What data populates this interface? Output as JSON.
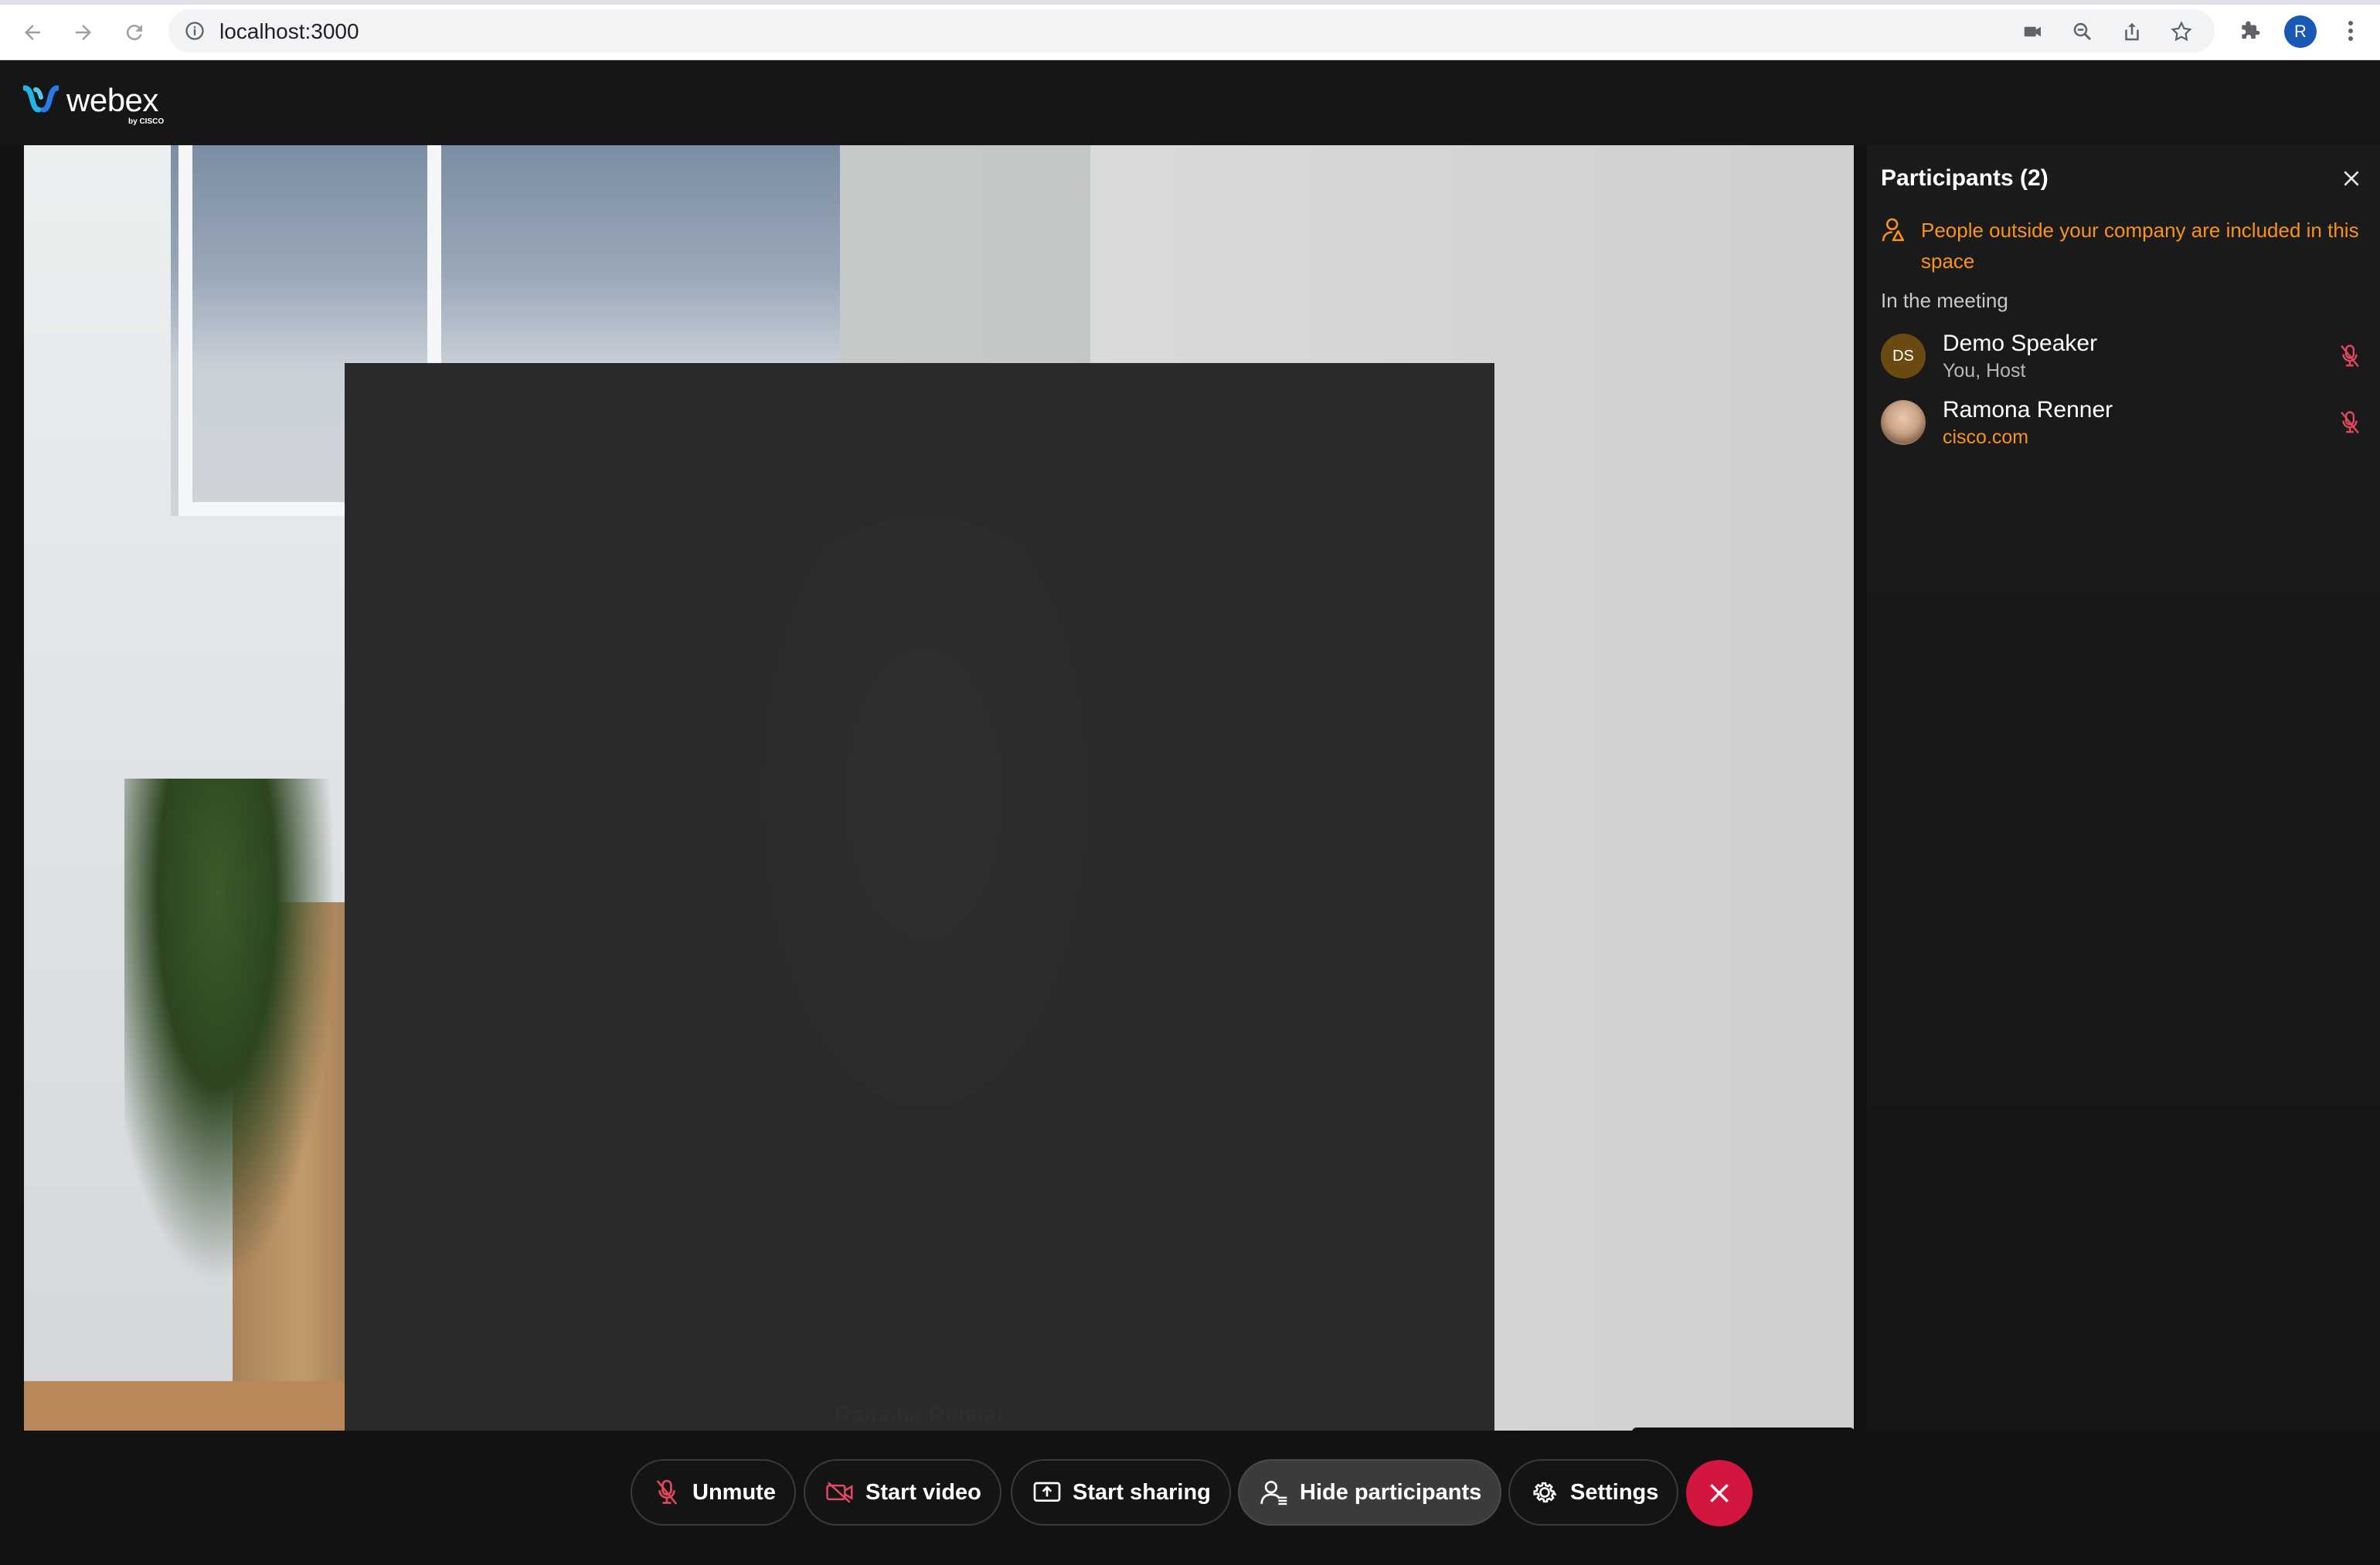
{
  "browser": {
    "url": "localhost:3000",
    "profile_initial": "R"
  },
  "app": {
    "logo_text": "webex",
    "logo_byline": "by CISCO"
  },
  "stage": {
    "remote_name": "Ramona Renner",
    "self_initials": "DS"
  },
  "participants": {
    "title": "Participants (2)",
    "warning": "People outside your company are included in this space",
    "section_label": "In the meeting",
    "list": [
      {
        "initials": "DS",
        "name": "Demo Speaker",
        "sub": "You, Host",
        "muted": true
      },
      {
        "initials": "",
        "name": "Ramona Renner",
        "sub": "cisco.com",
        "muted": true
      }
    ]
  },
  "controls": {
    "unmute": "Unmute",
    "start_video": "Start video",
    "start_sharing": "Start sharing",
    "hide_participants": "Hide participants",
    "settings": "Settings"
  },
  "colors": {
    "accent_orange": "#f7931e",
    "leave_red": "#d3163f",
    "avatar_purple": "#5a35c5",
    "muted_red": "#e0485f"
  }
}
